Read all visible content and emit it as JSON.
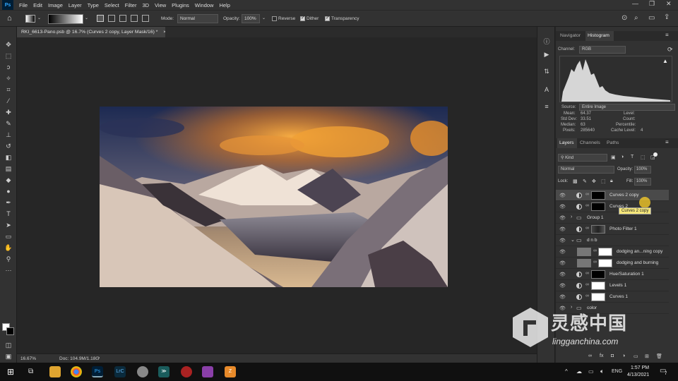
{
  "menubar": {
    "logo": "Ps",
    "items": [
      "File",
      "Edit",
      "Image",
      "Layer",
      "Type",
      "Select",
      "Filter",
      "3D",
      "View",
      "Plugins",
      "Window",
      "Help"
    ]
  },
  "options": {
    "mode_label": "Mode:",
    "mode_value": "Normal",
    "opacity_label": "Opacity:",
    "opacity_value": "100%",
    "reverse_label": "Reverse",
    "dither_label": "Dither",
    "transparency_label": "Transparency"
  },
  "document": {
    "tab_title": "RKI_6613-Pano.psb @ 16.7% (Curves 2 copy, Layer Mask/16) *",
    "zoom": "16.67%",
    "doc_size": "Doc: 104.9M/1.18G"
  },
  "histogram_panel": {
    "tabs": [
      "Navigator",
      "Histogram"
    ],
    "channel_label": "Channel:",
    "channel_value": "RGB",
    "source_label": "Source:",
    "source_value": "Entire Image",
    "stats_left": [
      {
        "label": "Mean:",
        "value": "64.37"
      },
      {
        "label": "Std Dev:",
        "value": "33.51"
      },
      {
        "label": "Median:",
        "value": "63"
      },
      {
        "label": "Pixels:",
        "value": "285640"
      }
    ],
    "stats_right": [
      {
        "label": "Level:",
        "value": ""
      },
      {
        "label": "Count:",
        "value": ""
      },
      {
        "label": "Percentile:",
        "value": ""
      },
      {
        "label": "Cache Level:",
        "value": "4"
      }
    ]
  },
  "layers_panel": {
    "tabs": [
      "Layers",
      "Channels",
      "Paths"
    ],
    "filter_label": "Kind",
    "blend_mode": "Normal",
    "opacity_label": "Opacity:",
    "opacity_value": "100%",
    "lock_label": "Lock:",
    "fill_label": "Fill:",
    "fill_value": "100%",
    "layers": [
      {
        "name": "Curves 2 copy",
        "type": "adjustment",
        "mask": "dark",
        "selected": true
      },
      {
        "name": "Curves 2",
        "type": "adjustment",
        "mask": "dark",
        "selected": false
      },
      {
        "name": "Group 1",
        "type": "group",
        "selected": false
      },
      {
        "name": "Photo Filter 1",
        "type": "photo",
        "selected": false
      },
      {
        "name": "d n b",
        "type": "group-open",
        "selected": false
      },
      {
        "name": "dodging an...ning copy",
        "type": "gray",
        "selected": false
      },
      {
        "name": "dodging and burning",
        "type": "gray",
        "selected": false
      },
      {
        "name": "Hue/Saturation 1",
        "type": "adjustment",
        "mask": "dark",
        "selected": false
      },
      {
        "name": "Levels 1",
        "type": "adjustment",
        "mask": "white",
        "selected": false
      },
      {
        "name": "Curves 1",
        "type": "adjustment",
        "mask": "white",
        "selected": false
      },
      {
        "name": "color",
        "type": "group",
        "selected": false
      }
    ]
  },
  "tooltip": "Curves 2 copy",
  "watermark": {
    "cn": "灵感中国",
    "url": "lingganchina.com"
  },
  "taskbar": {
    "lang": "ENG",
    "time": "1:57 PM",
    "date": "4/13/2021",
    "notif": "7"
  },
  "colors": {
    "accent": "#31a8ff",
    "selection": "#4a4a4a",
    "tooltip_bg": "#f5e67a"
  }
}
